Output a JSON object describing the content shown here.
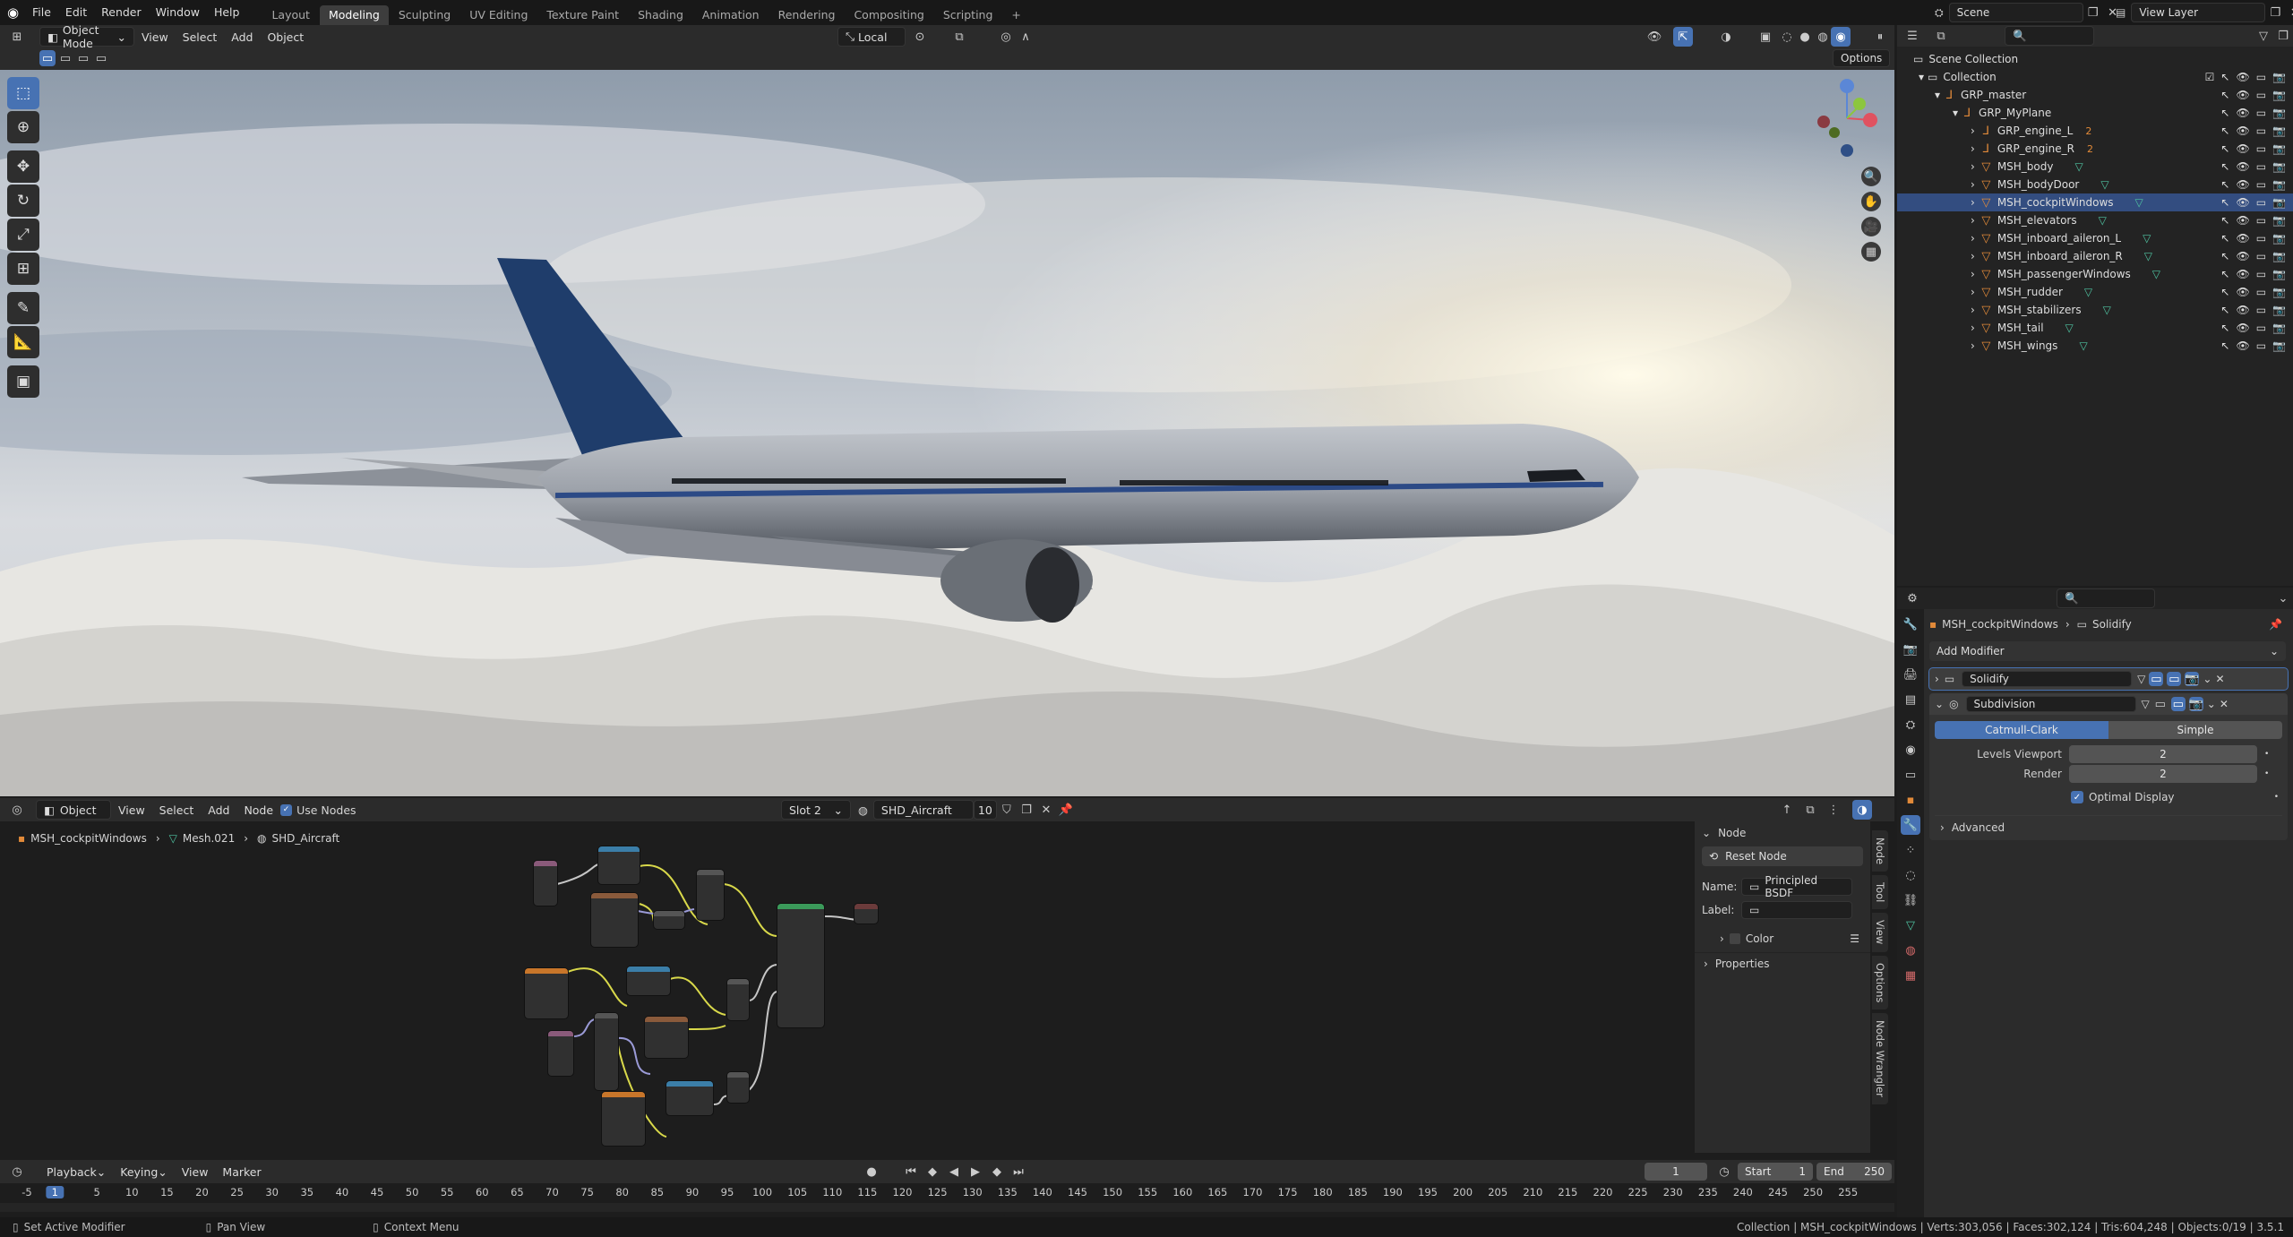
{
  "topbar": {
    "menus": [
      "File",
      "Edit",
      "Render",
      "Window",
      "Help"
    ],
    "workspaces": [
      "Layout",
      "Modeling",
      "Sculpting",
      "UV Editing",
      "Texture Paint",
      "Shading",
      "Animation",
      "Rendering",
      "Compositing",
      "Scripting"
    ],
    "active_workspace": "Modeling",
    "add_tab": "+",
    "scene": "Scene",
    "view_layer": "View Layer"
  },
  "viewport_header": {
    "mode": "Object Mode",
    "menus": [
      "View",
      "Select",
      "Add",
      "Object"
    ],
    "orientation": "Local",
    "options": "Options"
  },
  "outliner": {
    "root": "Scene Collection",
    "collection": "Collection",
    "grp_master": "GRP_master",
    "grp_plane": "GRP_MyPlane",
    "objects": [
      {
        "name": "GRP_engine_L",
        "sub": "2"
      },
      {
        "name": "GRP_engine_R",
        "sub": "2"
      },
      {
        "name": "MSH_body",
        "sub": ""
      },
      {
        "name": "MSH_bodyDoor",
        "sub": ""
      },
      {
        "name": "MSH_cockpitWindows",
        "sub": ""
      },
      {
        "name": "MSH_elevators",
        "sub": ""
      },
      {
        "name": "MSH_inboard_aileron_L",
        "sub": ""
      },
      {
        "name": "MSH_inboard_aileron_R",
        "sub": ""
      },
      {
        "name": "MSH_passengerWindows",
        "sub": ""
      },
      {
        "name": "MSH_rudder",
        "sub": ""
      },
      {
        "name": "MSH_stabilizers",
        "sub": ""
      },
      {
        "name": "MSH_tail",
        "sub": ""
      },
      {
        "name": "MSH_wings",
        "sub": ""
      }
    ]
  },
  "properties": {
    "breadcrumb_object": "MSH_cockpitWindows",
    "breadcrumb_modifier": "Solidify",
    "add_modifier": "Add Modifier",
    "mod1": "Solidify",
    "mod2": "Subdivision",
    "catmull": "Catmull-Clark",
    "simple": "Simple",
    "levels_viewport_label": "Levels Viewport",
    "levels_viewport": "2",
    "render_label": "Render",
    "render": "2",
    "optimal_display": "Optimal Display",
    "advanced": "Advanced"
  },
  "node_editor": {
    "header": {
      "object": "Object",
      "menus": [
        "View",
        "Select",
        "Add",
        "Node"
      ],
      "use_nodes": "Use Nodes",
      "slot": "Slot 2",
      "material": "SHD_Aircraft",
      "users": "10"
    },
    "breadcrumb": [
      "MSH_cockpitWindows",
      "Mesh.021",
      "SHD_Aircraft"
    ],
    "panel": {
      "section": "Node",
      "reset": "Reset Node",
      "name_label": "Name:",
      "name_value": "Principled BSDF",
      "label_label": "Label:",
      "color": "Color",
      "properties": "Properties"
    },
    "side_tabs": [
      "Node",
      "Tool",
      "View",
      "Options",
      "Node Wrangler"
    ]
  },
  "timeline": {
    "menus": [
      "Playback",
      "Keying",
      "View",
      "Marker"
    ],
    "current_frame": "1",
    "start_label": "Start",
    "start": "1",
    "end_label": "End",
    "end": "250",
    "ticks": [
      "-5",
      "1",
      "5",
      "10",
      "15",
      "20",
      "25",
      "30",
      "35",
      "40",
      "45",
      "50",
      "55",
      "60",
      "65",
      "70",
      "75",
      "80",
      "85",
      "90",
      "95",
      "100",
      "105",
      "110",
      "115",
      "120",
      "125",
      "130",
      "135",
      "140",
      "145",
      "150",
      "155",
      "160",
      "165",
      "170",
      "175",
      "180",
      "185",
      "190",
      "195",
      "200",
      "205",
      "210",
      "215",
      "220",
      "225",
      "230",
      "235",
      "240",
      "245",
      "250",
      "255"
    ]
  },
  "status": {
    "left1": "Set Active Modifier",
    "left2": "Pan View",
    "left3": "Context Menu",
    "right": "Collection | MSH_cockpitWindows | Verts:303,056 | Faces:302,124 | Tris:604,248 | Objects:0/19 | 3.5.1"
  },
  "colors": {
    "accent": "#4772b3",
    "object_orange": "#e28a39",
    "mesh_green": "#4fc3a1"
  }
}
